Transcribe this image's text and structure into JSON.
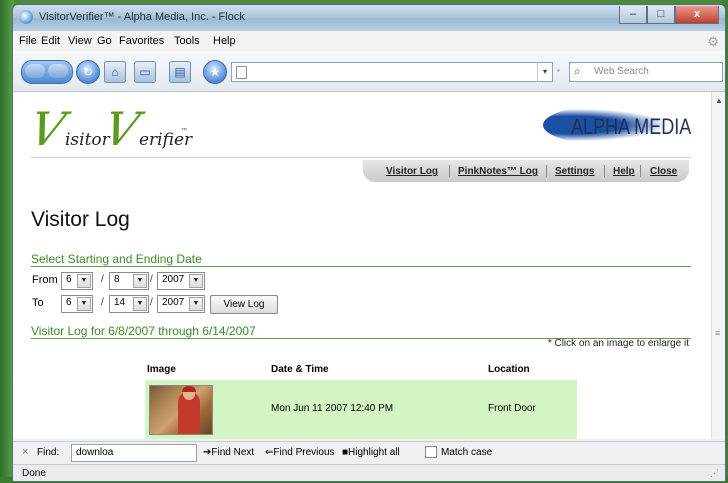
{
  "window": {
    "title": "VisitorVerifier™ - Alpha Media, Inc. - Flock",
    "controls": [
      "–",
      "□",
      "x"
    ]
  },
  "menu": [
    "File",
    "Edit",
    "View",
    "Go",
    "Favorites",
    "Tools",
    "Help"
  ],
  "toolbar": {
    "search_placeholder": "Web Search",
    "dropdown_glyph": "▾",
    "separator_glyph": "▪"
  },
  "header": {
    "logo_left": {
      "first": "isitor",
      "second": "erifier",
      "check": "V",
      "tm": "™"
    },
    "logo_right": "ALPHA MEDIA",
    "nav": [
      "Visitor Log",
      "PinkNotes™ Log",
      "Settings",
      "Help",
      "Close"
    ]
  },
  "page": {
    "title": "Visitor Log",
    "date_section": "Select Starting and Ending Date",
    "from_label": "From",
    "to_label": "To",
    "from": {
      "month": "6",
      "day": "8",
      "year": "2007"
    },
    "to": {
      "month": "6",
      "day": "14",
      "year": "2007"
    },
    "slash": "/",
    "view_log_button": "View Log",
    "log_section": "Visitor Log for 6/8/2007 through 6/14/2007",
    "hint": "* Click on an image to enlarge it",
    "table": {
      "headers": [
        "Image",
        "Date & Time",
        "Location"
      ],
      "rows": [
        {
          "datetime": "Mon Jun 11 2007 12:40 PM",
          "location": "Front Door"
        }
      ]
    }
  },
  "findbar": {
    "close": "×",
    "label": "Find:",
    "value": "downloa",
    "find_next": "Find Next",
    "find_previous": "Find Previous",
    "highlight_all": "Highlight all",
    "match_case": "Match case"
  },
  "status": {
    "text": "Done"
  },
  "colors": {
    "section_green": "#3a8a2a",
    "row_highlight": "#d3f5c3",
    "brand_blue": "#1b4fa3"
  },
  "icons": [
    "back-icon",
    "forward-icon",
    "reload-icon",
    "home-icon",
    "screen-icon",
    "feed-icon",
    "star-icon",
    "page-icon",
    "search-icon",
    "gear-icon"
  ]
}
